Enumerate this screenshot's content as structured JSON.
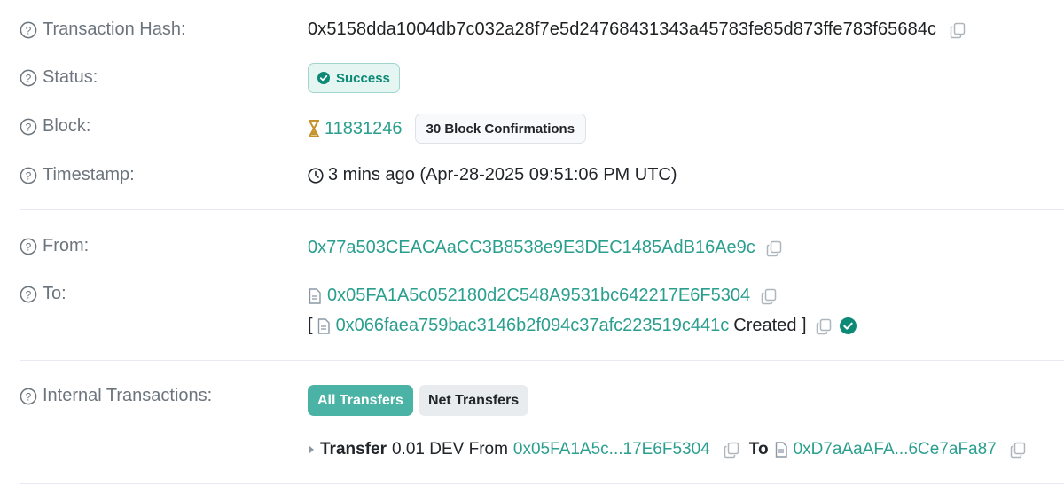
{
  "labels": {
    "tx_hash": "Transaction Hash:",
    "status": "Status:",
    "block": "Block:",
    "timestamp": "Timestamp:",
    "from": "From:",
    "to": "To:",
    "internal": "Internal Transactions:"
  },
  "tx_hash": "0x5158dda1004db7c032a28f7e5d24768431343a45783fe85d873ffe783f65684c",
  "status": "Success",
  "block": {
    "number": "11831246",
    "confirmations": "30 Block Confirmations"
  },
  "timestamp": "3 mins ago (Apr-28-2025 09:51:06 PM UTC)",
  "from_address": "0x77a503CEACAaCC3B8538e9E3DEC1485AdB16Ae9c",
  "to": {
    "address": "0x05FA1A5c052180d2C548A9531bc642217E6F5304",
    "created_open": "[",
    "created_address": "0x066faea759bac3146b2f094c37afc223519c441c",
    "created_text": "Created ]"
  },
  "internal": {
    "tabs": [
      "All Transfers",
      "Net Transfers"
    ],
    "transfer": {
      "label": "Transfer",
      "amount": "0.01 DEV From",
      "from": "0x05FA1A5c...17E6F5304",
      "to_label": "To",
      "to": "0xD7aAaAFA...6Ce7aFa87"
    }
  },
  "colors": {
    "link": "#2a9f8e",
    "success": "#0c8a76",
    "active_tab": "#4ab3a6"
  },
  "icons": [
    "question-circle-icon",
    "copy-icon",
    "check-circle-icon",
    "hourglass-icon",
    "clock-icon",
    "file-icon",
    "caret-right-icon"
  ]
}
